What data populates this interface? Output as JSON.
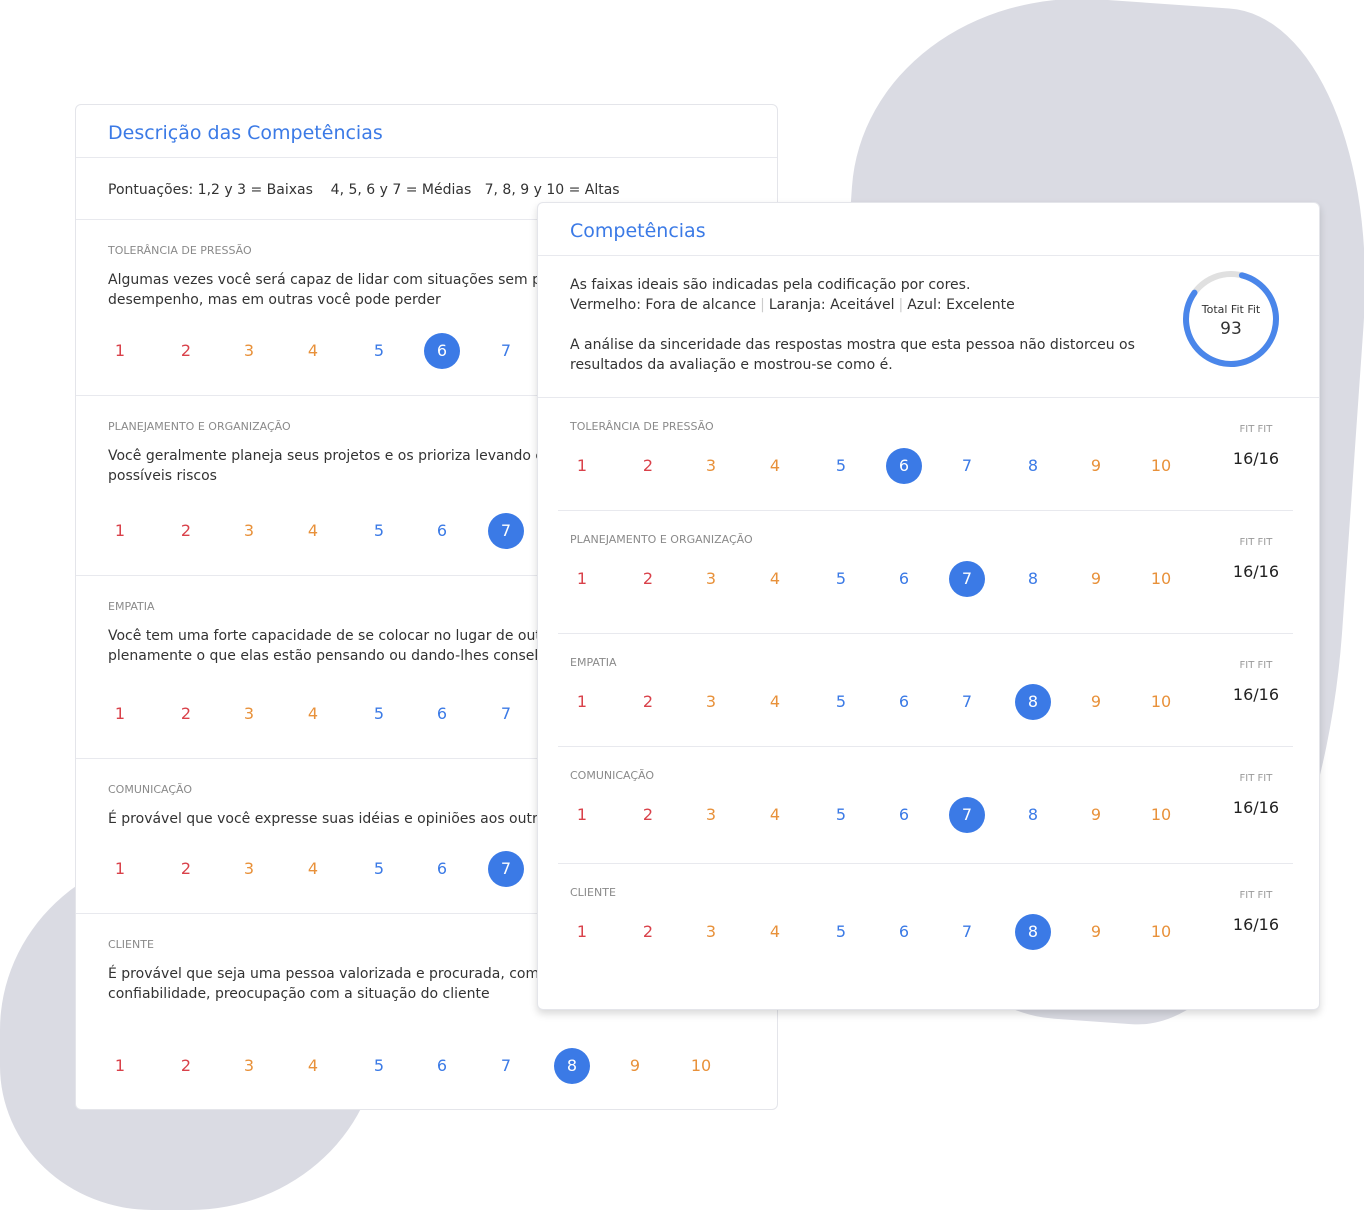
{
  "back": {
    "title": "Descrição das Competências",
    "scale_text": "Pontuações: 1,2 y 3 = Baixas    4, 5, 6 y 7 = Médias   7, 8, 9 y 10 = Altas",
    "sections": [
      {
        "label": "Tolerância de pressão",
        "lines": [
          "Algumas vezes você será capaz de lidar com situações sem prob",
          "desempenho, mas em outras você pode perder"
        ],
        "selected": 6
      },
      {
        "label": "Planejamento e organização",
        "lines": [
          "Você geralmente planeja seus projetos e os prioriza levando em",
          "possíveis riscos"
        ],
        "selected": 7
      },
      {
        "label": "Empatia",
        "lines": [
          "Você tem uma forte capacidade de se colocar no lugar de outras",
          "plenamente o que elas estão pensando ou dando-lhes conselho"
        ],
        "selected": 8
      },
      {
        "label": "Comunicação",
        "lines": [
          "É provável que você expresse suas idéias e opiniões aos outros"
        ],
        "selected": 7
      },
      {
        "label": "Cliente",
        "lines": [
          "É provável que seja uma pessoa valorizada e procurada, com ur",
          "confiabilidade, preocupação com a situação do cliente"
        ],
        "selected": 8
      }
    ]
  },
  "front": {
    "title": "Competências",
    "intro1": "As faixas ideais são indicadas pela codificação por cores.",
    "legend": [
      "Vermelho: Fora de alcance",
      "Laranja: Aceitável",
      "Azul: Excelente"
    ],
    "sincerity": [
      "A análise da sinceridade das respostas mostra que esta pessoa não distorceu os",
      "resultados da avaliação e mostrou-se como é."
    ],
    "gauge": {
      "label": "Total Fit Fit",
      "value": "93",
      "percent": 93
    },
    "fit_label": "FIT FIT",
    "sections": [
      {
        "label": "Tolerância de pressão",
        "selected": 6,
        "fit": "16/16"
      },
      {
        "label": "Planejamento e organização",
        "selected": 7,
        "fit": "16/16"
      },
      {
        "label": "Empatia",
        "selected": 8,
        "fit": "16/16"
      },
      {
        "label": "Comunicação",
        "selected": 7,
        "fit": "16/16"
      },
      {
        "label": "Cliente",
        "selected": 8,
        "fit": "16/16"
      }
    ]
  },
  "scores": [
    "1",
    "2",
    "3",
    "4",
    "5",
    "6",
    "7",
    "8",
    "9",
    "10"
  ],
  "colors": {
    "red": "#d9414a",
    "orange": "#e8913a",
    "blue": "#3b7ae6",
    "selected_bg": "#3b7ae6"
  },
  "score_colors": [
    "red",
    "red",
    "orange",
    "orange",
    "blue",
    "blue",
    "blue",
    "blue",
    "orange",
    "orange"
  ]
}
